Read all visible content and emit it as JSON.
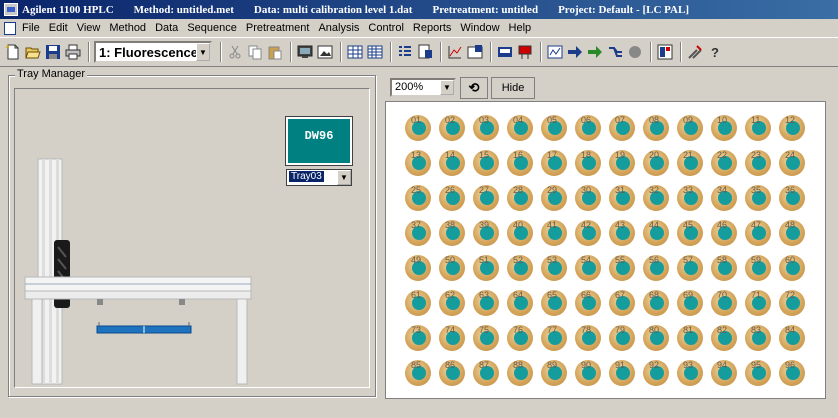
{
  "titlebar": {
    "app": "Agilent 1100 HPLC",
    "method": "Method: untitled.met",
    "data": "Data: multi calibration level 1.dat",
    "pretreatment": "Pretreatment: untitled",
    "project": "Project: Default - [LC PAL]"
  },
  "menu": [
    "File",
    "Edit",
    "View",
    "Method",
    "Data",
    "Sequence",
    "Pretreatment",
    "Analysis",
    "Control",
    "Reports",
    "Window",
    "Help"
  ],
  "toolbar": {
    "mode_value": "1: Fluorescence"
  },
  "tray_manager": {
    "label": "Tray Manager",
    "tray_type": "DW96",
    "tray_selected": "Tray03"
  },
  "vial_view": {
    "zoom": "200%",
    "hide_label": "Hide",
    "vials": [
      "01",
      "02",
      "03",
      "04",
      "05",
      "06",
      "07",
      "08",
      "09",
      "10",
      "11",
      "12",
      "13",
      "14",
      "15",
      "16",
      "17",
      "18",
      "19",
      "20",
      "21",
      "22",
      "23",
      "24",
      "25",
      "26",
      "27",
      "28",
      "29",
      "30",
      "31",
      "32",
      "33",
      "34",
      "35",
      "36",
      "37",
      "38",
      "39",
      "40",
      "41",
      "42",
      "43",
      "44",
      "45",
      "46",
      "47",
      "48",
      "49",
      "50",
      "51",
      "52",
      "53",
      "54",
      "55",
      "56",
      "57",
      "58",
      "59",
      "60",
      "61",
      "62",
      "63",
      "64",
      "65",
      "66",
      "67",
      "68",
      "69",
      "70",
      "71",
      "72",
      "73",
      "74",
      "75",
      "76",
      "77",
      "78",
      "79",
      "80",
      "81",
      "82",
      "83",
      "84",
      "85",
      "86",
      "87",
      "88",
      "89",
      "90",
      "91",
      "92",
      "93",
      "94",
      "95",
      "96"
    ]
  },
  "colors": {
    "titlebar": "#0a246a",
    "tray_box": "#008080",
    "vial_cap": "#d5a65c",
    "vial_sample": "#159c9c"
  }
}
